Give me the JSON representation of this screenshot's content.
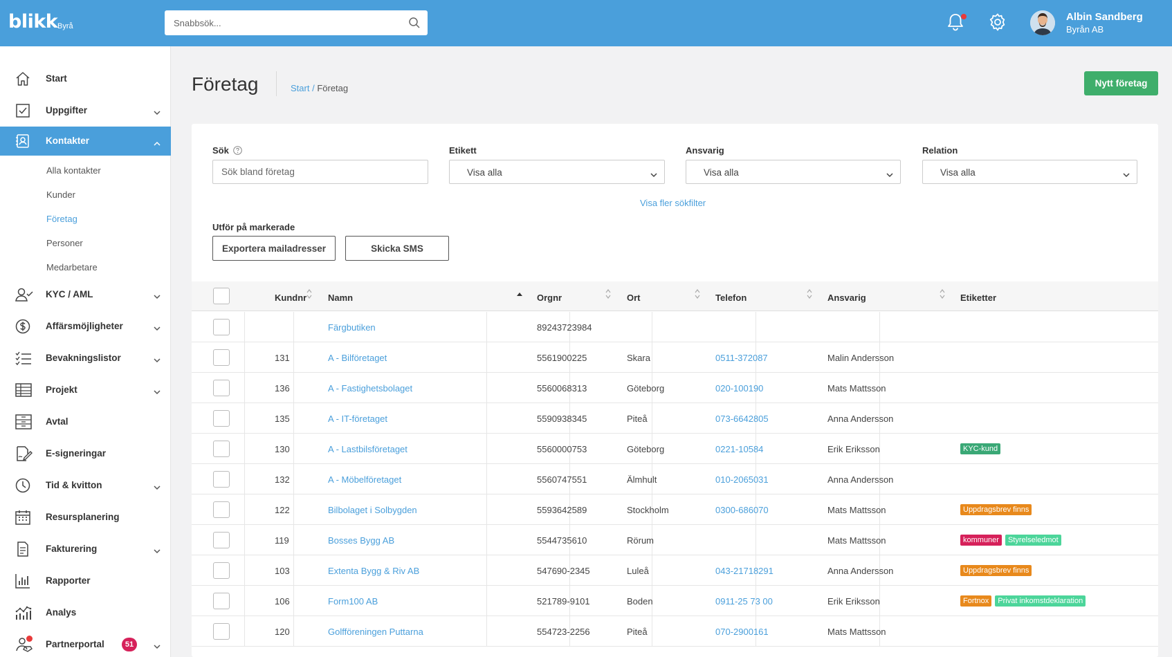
{
  "app": {
    "logo": "blikk",
    "logo_sub": "Byrå"
  },
  "search": {
    "placeholder": "Snabbsök..."
  },
  "user": {
    "name": "Albin Sandberg",
    "company": "Byrån AB"
  },
  "sidebar": {
    "items": [
      {
        "key": "start",
        "label": "Start",
        "icon": "home-icon",
        "chevron": false
      },
      {
        "key": "uppgifter",
        "label": "Uppgifter",
        "icon": "checkbox-icon",
        "chevron": true
      },
      {
        "key": "kontakter",
        "label": "Kontakter",
        "icon": "contact-book-icon",
        "chevron": true,
        "active": true
      },
      {
        "key": "kyc",
        "label": "KYC / AML",
        "icon": "user-check-icon",
        "chevron": true
      },
      {
        "key": "affarsmojligheter",
        "label": "Affärsmöjligheter",
        "icon": "dollar-icon",
        "chevron": true
      },
      {
        "key": "bevakningslistor",
        "label": "Bevakningslistor",
        "icon": "checklist-icon",
        "chevron": true
      },
      {
        "key": "projekt",
        "label": "Projekt",
        "icon": "table-icon",
        "chevron": true
      },
      {
        "key": "avtal",
        "label": "Avtal",
        "icon": "archive-icon",
        "chevron": false
      },
      {
        "key": "esign",
        "label": "E-signeringar",
        "icon": "signature-icon",
        "chevron": false
      },
      {
        "key": "tid",
        "label": "Tid & kvitton",
        "icon": "clock-icon",
        "chevron": true
      },
      {
        "key": "resurs",
        "label": "Resursplanering",
        "icon": "calendar-icon",
        "chevron": false
      },
      {
        "key": "fakturering",
        "label": "Fakturering",
        "icon": "invoice-icon",
        "chevron": true
      },
      {
        "key": "rapporter",
        "label": "Rapporter",
        "icon": "bar-chart-icon",
        "chevron": false
      },
      {
        "key": "analys",
        "label": "Analys",
        "icon": "analytics-icon",
        "chevron": false
      },
      {
        "key": "partner",
        "label": "Partnerportal",
        "icon": "partner-icon",
        "chevron": true,
        "badge": "51"
      }
    ],
    "subitems": [
      "Alla kontakter",
      "Kunder",
      "Företag",
      "Personer",
      "Medarbetare"
    ]
  },
  "page": {
    "title": "Företag",
    "breadcrumb_link": "Start",
    "breadcrumb_sep": " / ",
    "breadcrumb_current": "Företag",
    "new_button": "Nytt företag"
  },
  "filters": {
    "search_label": "Sök",
    "search_placeholder": "Sök bland företag",
    "etikett_label": "Etikett",
    "etikett_value": "Visa alla",
    "ansvarig_label": "Ansvarig",
    "ansvarig_value": "Visa alla",
    "relation_label": "Relation",
    "relation_value": "Visa alla",
    "more_filters": "Visa fler sökfilter"
  },
  "actions": {
    "label": "Utför på markerade",
    "export_button": "Exportera mailadresser",
    "sms_button": "Skicka SMS"
  },
  "table": {
    "columns": [
      "Kundnr",
      "Namn",
      "Orgnr",
      "Ort",
      "Telefon",
      "Ansvarig",
      "Etiketter"
    ],
    "rows": [
      {
        "kundnr": "",
        "namn": "Färgbutiken",
        "orgnr": "89243723984",
        "ort": "",
        "telefon": "",
        "ansvarig": "",
        "tags": []
      },
      {
        "kundnr": "131",
        "namn": "A - Bilföretaget",
        "orgnr": "5561900225",
        "ort": "Skara",
        "telefon": "0511-372087",
        "ansvarig": "Malin Andersson",
        "tags": []
      },
      {
        "kundnr": "136",
        "namn": "A - Fastighetsbolaget",
        "orgnr": "5560068313",
        "ort": "Göteborg",
        "telefon": "020-100190",
        "ansvarig": "Mats Mattsson",
        "tags": []
      },
      {
        "kundnr": "135",
        "namn": "A - IT-företaget",
        "orgnr": "5590938345",
        "ort": "Piteå",
        "telefon": "073-6642805",
        "ansvarig": "Anna Andersson",
        "tags": []
      },
      {
        "kundnr": "130",
        "namn": "A - Lastbilsföretaget",
        "orgnr": "5560000753",
        "ort": "Göteborg",
        "telefon": "0221-10584",
        "ansvarig": "Erik Eriksson",
        "tags": [
          {
            "text": "KYC-kund",
            "color": "#3aa876"
          }
        ]
      },
      {
        "kundnr": "132",
        "namn": "A - Möbelföretaget",
        "orgnr": "5560747551",
        "ort": "Älmhult",
        "telefon": "010-2065031",
        "ansvarig": "Anna Andersson",
        "tags": []
      },
      {
        "kundnr": "122",
        "namn": "Bilbolaget i Solbygden",
        "orgnr": "5593642589",
        "ort": "Stockholm",
        "telefon": "0300-686070",
        "ansvarig": "Mats Mattsson",
        "tags": [
          {
            "text": "Uppdragsbrev finns",
            "color": "#e8891c"
          }
        ]
      },
      {
        "kundnr": "119",
        "namn": "Bosses Bygg AB",
        "orgnr": "5544735610",
        "ort": "Rörum",
        "telefon": "",
        "ansvarig": "Mats Mattsson",
        "tags": [
          {
            "text": "kommuner",
            "color": "#d6215a"
          },
          {
            "text": "Styrelseledmot",
            "color": "#4cd59a"
          }
        ]
      },
      {
        "kundnr": "103",
        "namn": "Extenta Bygg & Riv AB",
        "orgnr": "547690-2345",
        "ort": "Luleå",
        "telefon": "043-21718291",
        "ansvarig": "Anna Andersson",
        "tags": [
          {
            "text": "Uppdragsbrev finns",
            "color": "#e8891c"
          }
        ]
      },
      {
        "kundnr": "106",
        "namn": "Form100 AB",
        "orgnr": "521789-9101",
        "ort": "Boden",
        "telefon": "0911-25 73 00",
        "ansvarig": "Erik Eriksson",
        "tags": [
          {
            "text": "Fortnox",
            "color": "#e8891c"
          },
          {
            "text": "Privat inkomstdeklaration",
            "color": "#4cd59a"
          }
        ]
      },
      {
        "kundnr": "120",
        "namn": "Golfföreningen Puttarna",
        "orgnr": "554723-2256",
        "ort": "Piteå",
        "telefon": "070-2900161",
        "ansvarig": "Mats Mattsson",
        "tags": []
      }
    ]
  }
}
